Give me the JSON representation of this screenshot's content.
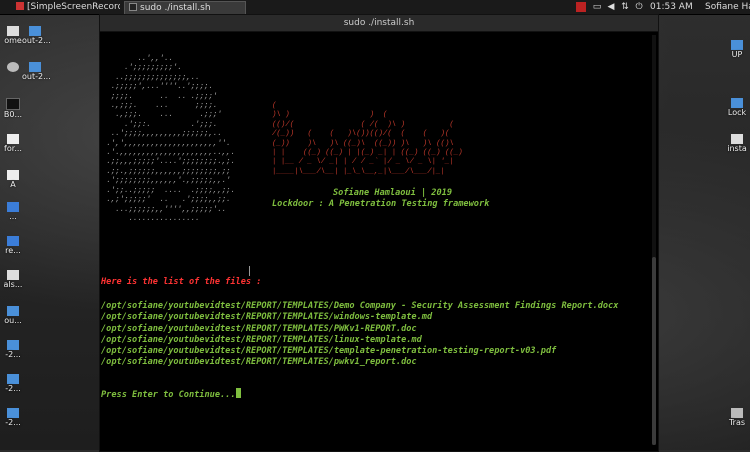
{
  "taskbar": {
    "task1": "[SimpleScreenRecorder]",
    "task2": "sudo ./install.sh",
    "clock": "01:53 AM",
    "user": "Sofiane Ham",
    "tray_icons": [
      "recording-icon",
      "monitor-icon",
      "volume-icon",
      "network-icon",
      "power-icon"
    ]
  },
  "desktop": {
    "left_icons": [
      "ome",
      "out-2...",
      "out-2...",
      "B0...",
      "for...",
      "A",
      "...",
      "re...",
      "als...",
      "ou...",
      "-2...",
      "-2...",
      "-2..."
    ],
    "right_icons": [
      "UP",
      "Lock",
      "insta",
      "Tras"
    ]
  },
  "terminal": {
    "title": "sudo ./install.sh",
    "ascii_art": "        ..',,'..\n     .';;;;;;;;;'.\n   ..;;;;;;;;;;;;;;,..\n  .;;;;;',...''''..';;;;.\n  ;;;;.      ..  .. .;;;;'\n  .,;;;.    ...      ;;;;.\n   .,;;;.    ...      .;;;'\n     .';;:.         .';;;.\n  ..';;;;,,,,,,,,,;;;;;;,..\n .',',,,,,,,,,,,,,,,,,,,,,''.\n .'.,,,,,,,,,,,,,,,,,,,,,..,,.\n .;;,,,;;;;;'....';;;;;;;;.,;.\n .;;.,;;;;;;,,,,,,;;;;;;;;,;;\n .';;;;;;;;,,,,,,'.,;;;;;,,.'\n .';;..;;;;;  ....  .;;;;,,;;.\n .,;';;;;;'  ..   .';;;;,,;;.\n   ...;;;;;;,,'''',,;;;;;'..\n      ................",
    "logo_art": "(\n)\\ )                  )  (\n(()/(               ( /(  )\\ )          (\n/(_))   (    (   )\\())(()/(  (    (   )(\n(_))    )\\   )\\ ((_)\\  ((_)) )\\   )\\ (()\\\n| |    ((_) ((_) | |(_) _| | ((_) ((_) ((_)\n| |__ / _ \\/ _| | / / _` |/ _ \\/ _ \\| '_|\n|____|\\___/\\__| |_\\_\\__,_|\\___/\\___/|_|",
    "author": "Sofiane Hamlaoui | 2019",
    "tagline": "Lockdoor : A Penetration Testing framework",
    "list_heading": "Here is the list of the files :",
    "files": [
      "/opt/sofiane/youtubevidtest/REPORT/TEMPLATES/Demo Company - Security Assessment Findings Report.docx",
      "/opt/sofiane/youtubevidtest/REPORT/TEMPLATES/windows-template.md",
      "/opt/sofiane/youtubevidtest/REPORT/TEMPLATES/PWKv1-REPORT.doc",
      "/opt/sofiane/youtubevidtest/REPORT/TEMPLATES/linux-template.md",
      "/opt/sofiane/youtubevidtest/REPORT/TEMPLATES/template-penetration-testing-report-v03.pdf",
      "/opt/sofiane/youtubevidtest/REPORT/TEMPLATES/pwkv1_report.doc"
    ],
    "prompt": "Press Enter to Continue..."
  },
  "colors": {
    "green": "#7fbf3f",
    "red_heading": "#ff3333",
    "logo_red": "#c0392b",
    "ascii_grey": "#a9a9a9"
  }
}
